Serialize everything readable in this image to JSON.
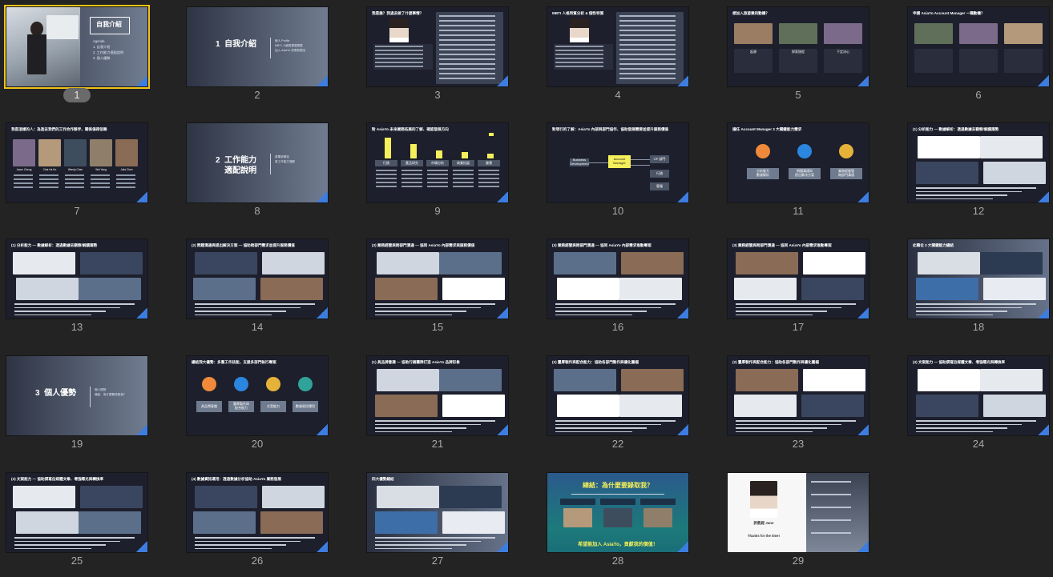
{
  "view": "slide-sorter",
  "selected_slide": 1,
  "colors": {
    "background": "#232323",
    "selection": "#f2c417",
    "corner_badge": "#3d7de0",
    "dark_slide": "#1d1f2c",
    "gradient_slide_start": "#2e3444",
    "gradient_slide_end": "#707c90",
    "yellow_accent": "#f4ef5a"
  },
  "slides": [
    {
      "number": "1",
      "style": "title",
      "heading": "自我介紹",
      "lines": [
        "Agenda",
        "1. 自我介紹",
        "2. 工作能力適配說明",
        "3. 個人優勢"
      ]
    },
    {
      "number": "2",
      "style": "section",
      "heading": "1  自我介紹",
      "lines": [
        "個人 Profile",
        "MBTI 人格與實習經驗",
        "加入 AsiaYo 初衷與想法"
      ]
    },
    {
      "number": "3",
      "style": "profile",
      "heading": "我是誰？我過去做了什麼事情？",
      "lines": []
    },
    {
      "number": "4",
      "style": "profile",
      "heading": "MBTI 人格特質分析 & 個性特質",
      "lines": []
    },
    {
      "number": "5",
      "style": "photos3",
      "heading": "想加入旅遊業的動機？",
      "lines": [
        "起源",
        "探索過程",
        "下定決心"
      ]
    },
    {
      "number": "6",
      "style": "photos3",
      "heading": "申請 AsiaYo Account Manager 一職動機？",
      "lines": []
    },
    {
      "number": "7",
      "style": "people",
      "heading": "我是這樣的人：為進去我們的工作合作夥伴，關係值得信賴",
      "lines": [
        "Jason Cheng",
        "Chia Ha Ho",
        "Wendy Chen",
        "Wei Yang",
        "Julia Chen"
      ]
    },
    {
      "number": "8",
      "style": "section",
      "heading": "2  工作能力\n    適配說明",
      "lines": [
        "將需求轉化",
        "將工作能力適配"
      ]
    },
    {
      "number": "9",
      "style": "bars",
      "heading": "對 AsiaYo 未來業務拓展的了解、確認發展方向",
      "lines": [
        "行銷",
        "產品研究",
        "市場分析",
        "商業拓展",
        "營運"
      ]
    },
    {
      "number": "10",
      "style": "flow",
      "heading": "對現行的了解：AsiaYo 內部與部門協作、協助發展需要並提升服務價值",
      "lines": [
        "Business Development",
        "Account Manager",
        "OP 部門",
        "行銷",
        "客服"
      ]
    },
    {
      "number": "11",
      "style": "icons",
      "heading": "擔任 Account Manager 3 大關鍵能力需求",
      "lines": [
        "分析能力\n數據解析",
        "問題溝通與\n提出解決方案",
        "業務經營管\n跨部門溝通"
      ]
    },
    {
      "number": "12",
      "style": "dense",
      "heading": "(1) 分析能力 — 數據解析：透過數據去觀察/解讀趨勢",
      "lines": []
    },
    {
      "number": "13",
      "style": "dense",
      "heading": "(1) 分析能力 — 數據解析：透過數據去觀察/解讀趨勢",
      "lines": []
    },
    {
      "number": "14",
      "style": "dense",
      "heading": "(2) 問題溝通與提出解決方案 — 協助跨部門需求並提升服務價值",
      "lines": []
    },
    {
      "number": "15",
      "style": "dense",
      "heading": "(3) 業務經營與跨部門溝通 — 協同 AsiaYo 內部需求與服務價值",
      "lines": []
    },
    {
      "number": "16",
      "style": "dense",
      "heading": "(3) 業務經營與跨部門溝通 — 協同 AsiaYo 內部需求推動專案",
      "lines": []
    },
    {
      "number": "17",
      "style": "dense",
      "heading": "(3) 業務經營與跨部門溝通 — 協同 AsiaYo 內部需求推動專案",
      "lines": []
    },
    {
      "number": "18",
      "style": "dense-light",
      "heading": "此職位 3 大關鍵能力總結",
      "lines": []
    },
    {
      "number": "19",
      "style": "section",
      "heading": "3  個人優勢",
      "lines": [
        "個人優勢",
        "總結：為什麼要錄取我？"
      ]
    },
    {
      "number": "20",
      "style": "icons4",
      "heading": "總結我大優勢：多重工作技能，支援多部門執行專案",
      "lines": [
        "具品牌意識",
        "豐厚製作與\n配合能力",
        "文案能力",
        "數據資訊運用"
      ]
    },
    {
      "number": "21",
      "style": "dense",
      "heading": "(1) 具品牌意識 — 協助行銷團隊打造 AsiaYo 品牌形象",
      "lines": []
    },
    {
      "number": "22",
      "style": "dense",
      "heading": "(2) 豐厚製作與配合能力：協助各部門製作與優化圖檔",
      "lines": []
    },
    {
      "number": "23",
      "style": "dense",
      "heading": "(2) 豐厚製作與配合能力：協助各部門製作與優化圖檔",
      "lines": []
    },
    {
      "number": "24",
      "style": "dense",
      "heading": "(3) 文案能力 — 協助撰寫自媒體文章、增強曝光與轉換率",
      "lines": []
    },
    {
      "number": "25",
      "style": "dense",
      "heading": "(3) 文案能力 — 協助撰寫自媒體文章、增強曝光與轉換率",
      "lines": []
    },
    {
      "number": "26",
      "style": "dense",
      "heading": "(4) 數據資訊運用：透過數據分析協助 AsiaYo 業務發展",
      "lines": []
    },
    {
      "number": "27",
      "style": "dense-light",
      "heading": "四大優勢總結",
      "lines": []
    },
    {
      "number": "28",
      "style": "summary",
      "heading": "總結：為什麼要錄取我？",
      "lines": [
        "希望能加入 AsiaYo，貢獻我的價值！"
      ]
    },
    {
      "number": "29",
      "style": "closing",
      "heading": "許凱妮 Jane",
      "lines": [
        "Thanks for the time!"
      ]
    }
  ]
}
